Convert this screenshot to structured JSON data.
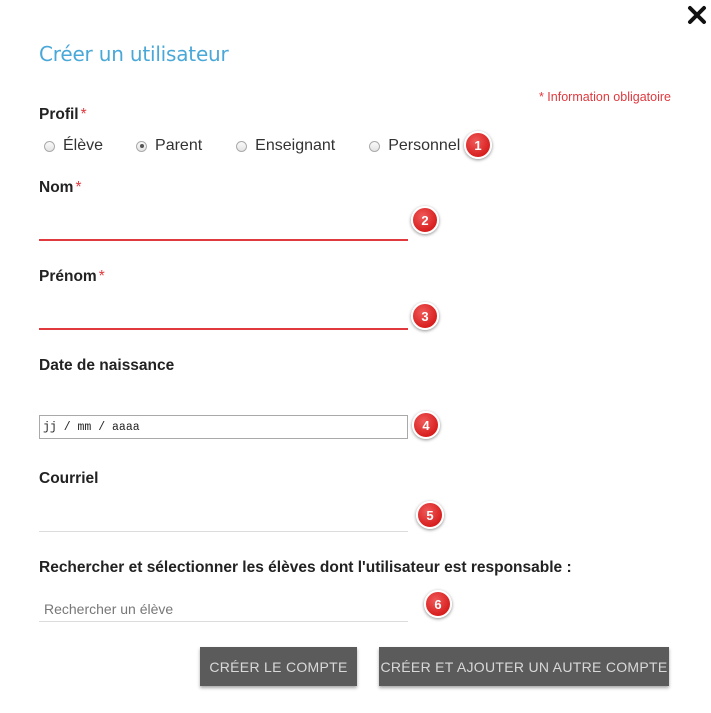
{
  "dialog": {
    "title": "Créer un utilisateur",
    "required_note": "* Information obligatoire",
    "close_icon": "close-icon"
  },
  "profil": {
    "label": "Profil",
    "required_mark": "*",
    "options": [
      "Élève",
      "Parent",
      "Enseignant",
      "Personnel"
    ],
    "selected": "Parent"
  },
  "fields": {
    "nom": {
      "label": "Nom",
      "required_mark": "*",
      "value": ""
    },
    "prenom": {
      "label": "Prénom",
      "required_mark": "*",
      "value": ""
    },
    "date": {
      "label": "Date de naissance",
      "placeholder": "jj / mm / aaaa"
    },
    "courriel": {
      "label": "Courriel",
      "value": ""
    },
    "search": {
      "label": "Rechercher et sélectionner les élèves dont l'utilisateur est responsable :",
      "placeholder": "Rechercher un élève"
    }
  },
  "badges": [
    "1",
    "2",
    "3",
    "4",
    "5",
    "6"
  ],
  "buttons": {
    "create": "CRÉER LE COMPTE",
    "create_add": "CRÉER ET AJOUTER UN AUTRE COMPTE"
  },
  "colors": {
    "title": "#4aa8d8",
    "required": "#e0393e",
    "button_bg": "#5b5b5b",
    "badge": "#d81f1f"
  }
}
